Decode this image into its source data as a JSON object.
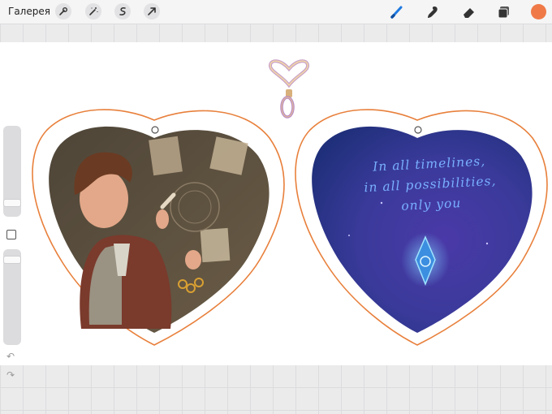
{
  "toolbar": {
    "gallery_label": "Галерея",
    "left_tools": [
      "wrench-icon",
      "magic-wand-icon",
      "selection-icon",
      "transform-icon"
    ],
    "right_tools": [
      "brush-icon",
      "smudge-icon",
      "eraser-icon",
      "layers-icon"
    ],
    "active_tool": "brush-icon",
    "current_color": "#ef7a48"
  },
  "sidebar": {
    "controls": [
      "brush-size-slider",
      "modify-button",
      "opacity-slider",
      "undo-button",
      "redo-button"
    ]
  },
  "artwork": {
    "poem_lines": [
      "In all timelines,",
      "in all possibilities,",
      "only you"
    ],
    "outline_color": "#e8803c"
  }
}
